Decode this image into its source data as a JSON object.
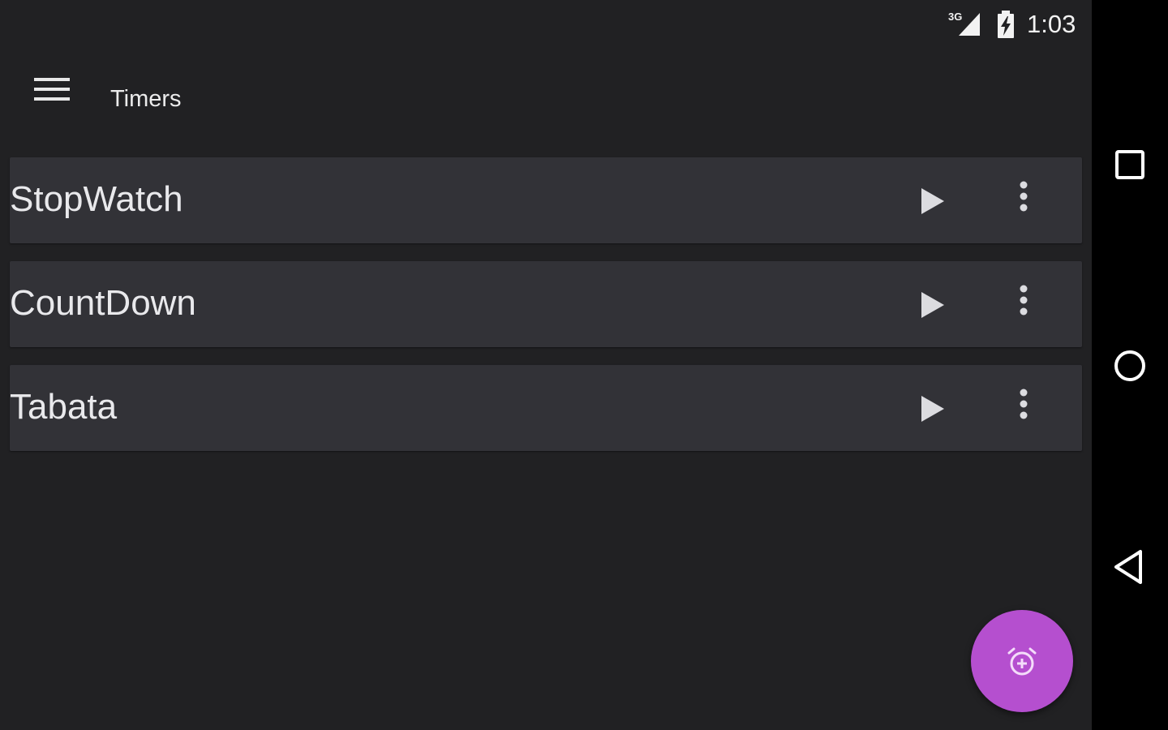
{
  "status_bar": {
    "network_type": "3G",
    "time": "1:03",
    "signal_icon": "signal-icon",
    "battery_icon": "battery-charging-icon"
  },
  "app_bar": {
    "title": "Timers",
    "menu_icon": "hamburger-menu-icon"
  },
  "timers": [
    {
      "name": "StopWatch",
      "play_icon": "play-icon",
      "more_icon": "more-vertical-icon"
    },
    {
      "name": "CountDown",
      "play_icon": "play-icon",
      "more_icon": "more-vertical-icon"
    },
    {
      "name": "Tabata",
      "play_icon": "play-icon",
      "more_icon": "more-vertical-icon"
    }
  ],
  "fab": {
    "icon": "add-alarm-icon",
    "color": "#b54fcf"
  },
  "navigation_bar": {
    "recents_icon": "recents-square-icon",
    "home_icon": "home-circle-icon",
    "back_icon": "back-triangle-icon"
  },
  "colors": {
    "background": "#212123",
    "card": "#323237",
    "text": "#e9e9ec",
    "accent": "#b54fcf"
  }
}
